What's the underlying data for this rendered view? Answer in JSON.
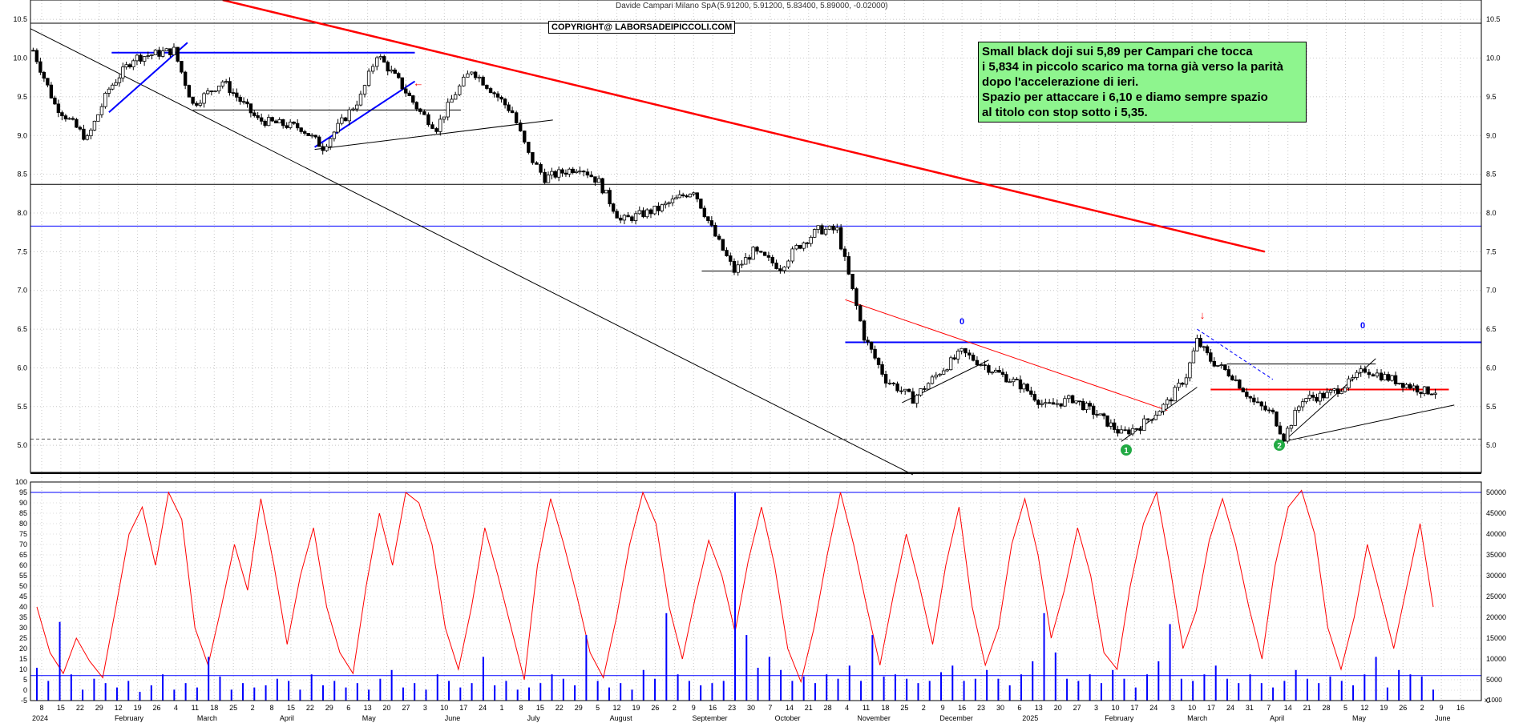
{
  "chart_title": {
    "name": "Davide Campari Milano SpA",
    "ohlc": "(5.91200, 5.91200, 5.83400, 5.89000, -0.02000)"
  },
  "copyright": "COPYRIGHT@ LABORSADEIPICCOLI.COM",
  "annotation": {
    "lines": [
      "Small black doji sui 5,89 per Campari che tocca",
      "i 5,834 in piccolo scarico ma torna già verso la parità",
      "dopo l'accelerazione di ieri.",
      "Spazio per attaccare i 6,10 e diamo sempre spazio",
      "al titolo con stop sotto i 5,35."
    ],
    "background": "#8ef58e"
  },
  "markers": {
    "wave_label_1": "0",
    "wave_label_2": "0",
    "circle_1": "1",
    "circle_2": "2",
    "down_arrow": "↓",
    "left_arrow": "←"
  },
  "colors": {
    "price_line": "#000000",
    "trend_red": "#ff0000",
    "trend_blue": "#0000ff",
    "oscillator": "#ff0000",
    "volume": "#0000ff",
    "green_marker": "#22aa44"
  },
  "chart_data": [
    {
      "type": "candlestick",
      "name": "price",
      "ylim": [
        4.65,
        10.75
      ],
      "yticks": [
        "10.5",
        "10.0",
        "9.5",
        "9.0",
        "8.5",
        "8.0",
        "7.5",
        "7.0",
        "6.5",
        "6.0",
        "5.5",
        "5.0"
      ],
      "horizontal_levels": [
        10.45,
        8.37,
        7.83,
        7.25,
        6.33,
        5.08
      ],
      "series_anchor_points": [
        [
          "2024-01-02",
          10.1
        ],
        [
          "2024-01-10",
          9.4
        ],
        [
          "2024-01-22",
          8.95
        ],
        [
          "2024-01-30",
          9.6
        ],
        [
          "2024-02-08",
          10.0
        ],
        [
          "2024-02-23",
          10.1
        ],
        [
          "2024-03-01",
          9.4
        ],
        [
          "2024-03-12",
          9.7
        ],
        [
          "2024-03-25",
          9.2
        ],
        [
          "2024-04-10",
          9.1
        ],
        [
          "2024-04-18",
          8.85
        ],
        [
          "2024-05-02",
          9.5
        ],
        [
          "2024-05-08",
          10.05
        ],
        [
          "2024-05-16",
          9.7
        ],
        [
          "2024-05-24",
          9.3
        ],
        [
          "2024-05-30",
          9.1
        ],
        [
          "2024-06-06",
          9.55
        ],
        [
          "2024-06-12",
          9.85
        ],
        [
          "2024-06-19",
          9.6
        ],
        [
          "2024-06-27",
          9.3
        ],
        [
          "2024-07-03",
          8.75
        ],
        [
          "2024-07-09",
          8.45
        ],
        [
          "2024-07-22",
          8.6
        ],
        [
          "2024-07-29",
          8.4
        ],
        [
          "2024-08-06",
          7.9
        ],
        [
          "2024-08-20",
          8.05
        ],
        [
          "2024-09-02",
          8.3
        ],
        [
          "2024-09-10",
          7.7
        ],
        [
          "2024-09-17",
          7.25
        ],
        [
          "2024-09-24",
          7.5
        ],
        [
          "2024-10-04",
          7.3
        ],
        [
          "2024-10-10",
          7.55
        ],
        [
          "2024-10-18",
          7.78
        ],
        [
          "2024-10-25",
          7.78
        ],
        [
          "2024-11-04",
          6.4
        ],
        [
          "2024-11-12",
          5.85
        ],
        [
          "2024-11-22",
          5.6
        ],
        [
          "2024-12-02",
          5.95
        ],
        [
          "2024-12-10",
          6.2
        ],
        [
          "2024-12-20",
          6.0
        ],
        [
          "2025-01-02",
          5.75
        ],
        [
          "2025-01-10",
          5.5
        ],
        [
          "2025-01-20",
          5.6
        ],
        [
          "2025-01-29",
          5.4
        ],
        [
          "2025-02-07",
          5.15
        ],
        [
          "2025-02-14",
          5.25
        ],
        [
          "2025-02-24",
          5.55
        ],
        [
          "2025-03-03",
          5.9
        ],
        [
          "2025-03-07",
          6.35
        ],
        [
          "2025-03-12",
          6.1
        ],
        [
          "2025-03-20",
          5.9
        ],
        [
          "2025-03-28",
          5.55
        ],
        [
          "2025-04-04",
          5.4
        ],
        [
          "2025-04-08",
          5.1
        ],
        [
          "2025-04-15",
          5.6
        ],
        [
          "2025-04-24",
          5.65
        ],
        [
          "2025-05-02",
          5.8
        ],
        [
          "2025-05-08",
          5.98
        ],
        [
          "2025-05-14",
          5.9
        ],
        [
          "2025-05-22",
          5.8
        ],
        [
          "2025-05-30",
          5.7
        ],
        [
          "2025-06-03",
          5.7
        ],
        [
          "2025-06-05",
          5.89
        ]
      ],
      "last_close": 5.89
    },
    {
      "type": "line",
      "name": "oscillator",
      "ylim": [
        -5,
        100
      ],
      "yticks": [
        "100",
        "95",
        "90",
        "85",
        "80",
        "75",
        "70",
        "65",
        "60",
        "55",
        "50",
        "45",
        "40",
        "35",
        "30",
        "25",
        "20",
        "15",
        "10",
        "5",
        "0",
        "-5"
      ],
      "horizontal_levels": [
        95,
        7
      ],
      "values": [
        40,
        18,
        8,
        25,
        14,
        6,
        40,
        75,
        88,
        60,
        95,
        82,
        30,
        12,
        40,
        70,
        48,
        92,
        60,
        22,
        55,
        78,
        40,
        18,
        8,
        50,
        85,
        60,
        95,
        90,
        70,
        30,
        10,
        40,
        78,
        55,
        30,
        5,
        60,
        92,
        70,
        45,
        18,
        6,
        35,
        70,
        95,
        80,
        40,
        15,
        45,
        72,
        55,
        28,
        62,
        88,
        60,
        20,
        4,
        30,
        65,
        95,
        70,
        40,
        12,
        45,
        75,
        50,
        22,
        60,
        88,
        40,
        12,
        30,
        70,
        92,
        65,
        25,
        48,
        78,
        55,
        18,
        10,
        50,
        80,
        95,
        60,
        20,
        38,
        72,
        92,
        70,
        40,
        15,
        60,
        88,
        96,
        75,
        30,
        10,
        35,
        70,
        45,
        20,
        50,
        80,
        40
      ]
    },
    {
      "type": "bar",
      "name": "volume",
      "ylim": [
        0,
        50000
      ],
      "right_yticks": [
        "50000",
        "45000",
        "40000",
        "35000",
        "30000",
        "25000",
        "20000",
        "15000",
        "10000",
        "5000",
        "0"
      ],
      "values": [
        15,
        9,
        36,
        12,
        5,
        10,
        8,
        6,
        9,
        4,
        7,
        12,
        5,
        8,
        6,
        20,
        11,
        5,
        8,
        6,
        7,
        10,
        9,
        5,
        12,
        7,
        9,
        6,
        8,
        5,
        10,
        14,
        6,
        8,
        5,
        12,
        9,
        6,
        8,
        20,
        7,
        9,
        5,
        6,
        8,
        12,
        10,
        7,
        30,
        9,
        6,
        8,
        5,
        14,
        10,
        40,
        12,
        9,
        7,
        8,
        9,
        95,
        30,
        15,
        20,
        14,
        9,
        11,
        8,
        12,
        10,
        16,
        9,
        30,
        11,
        12,
        10,
        8,
        9,
        13,
        16,
        9,
        10,
        14,
        10,
        7,
        12,
        18,
        40,
        22,
        10,
        9,
        12,
        8,
        14,
        10,
        6,
        12,
        18,
        35,
        10,
        9,
        12,
        16,
        10,
        8,
        12,
        8,
        6,
        9,
        14,
        10,
        8,
        11,
        9,
        7,
        12,
        20,
        6,
        14,
        12,
        11,
        5
      ]
    }
  ],
  "x_axis": {
    "month_labels": [
      "2024",
      "February",
      "March",
      "April",
      "May",
      "June",
      "July",
      "August",
      "September",
      "October",
      "November",
      "December",
      "2025",
      "February",
      "March",
      "April",
      "May",
      "June"
    ],
    "day_labels": [
      "8",
      "15",
      "22",
      "29",
      "12",
      "19",
      "26",
      "4",
      "11",
      "18",
      "25",
      "2",
      "8",
      "15",
      "22",
      "29",
      "6",
      "13",
      "20",
      "27",
      "3",
      "10",
      "17",
      "24",
      "1",
      "8",
      "15",
      "22",
      "29",
      "5",
      "12",
      "19",
      "26",
      "2",
      "9",
      "16",
      "23",
      "30",
      "7",
      "14",
      "21",
      "28",
      "4",
      "11",
      "18",
      "25",
      "2",
      "9",
      "16",
      "23",
      "30",
      "6",
      "13",
      "20",
      "27",
      "3",
      "10",
      "17",
      "24",
      "3",
      "10",
      "17",
      "24",
      "31",
      "7",
      "14",
      "21",
      "28",
      "5",
      "12",
      "19",
      "26",
      "2",
      "9",
      "16"
    ],
    "volume_unit": "x1000"
  }
}
